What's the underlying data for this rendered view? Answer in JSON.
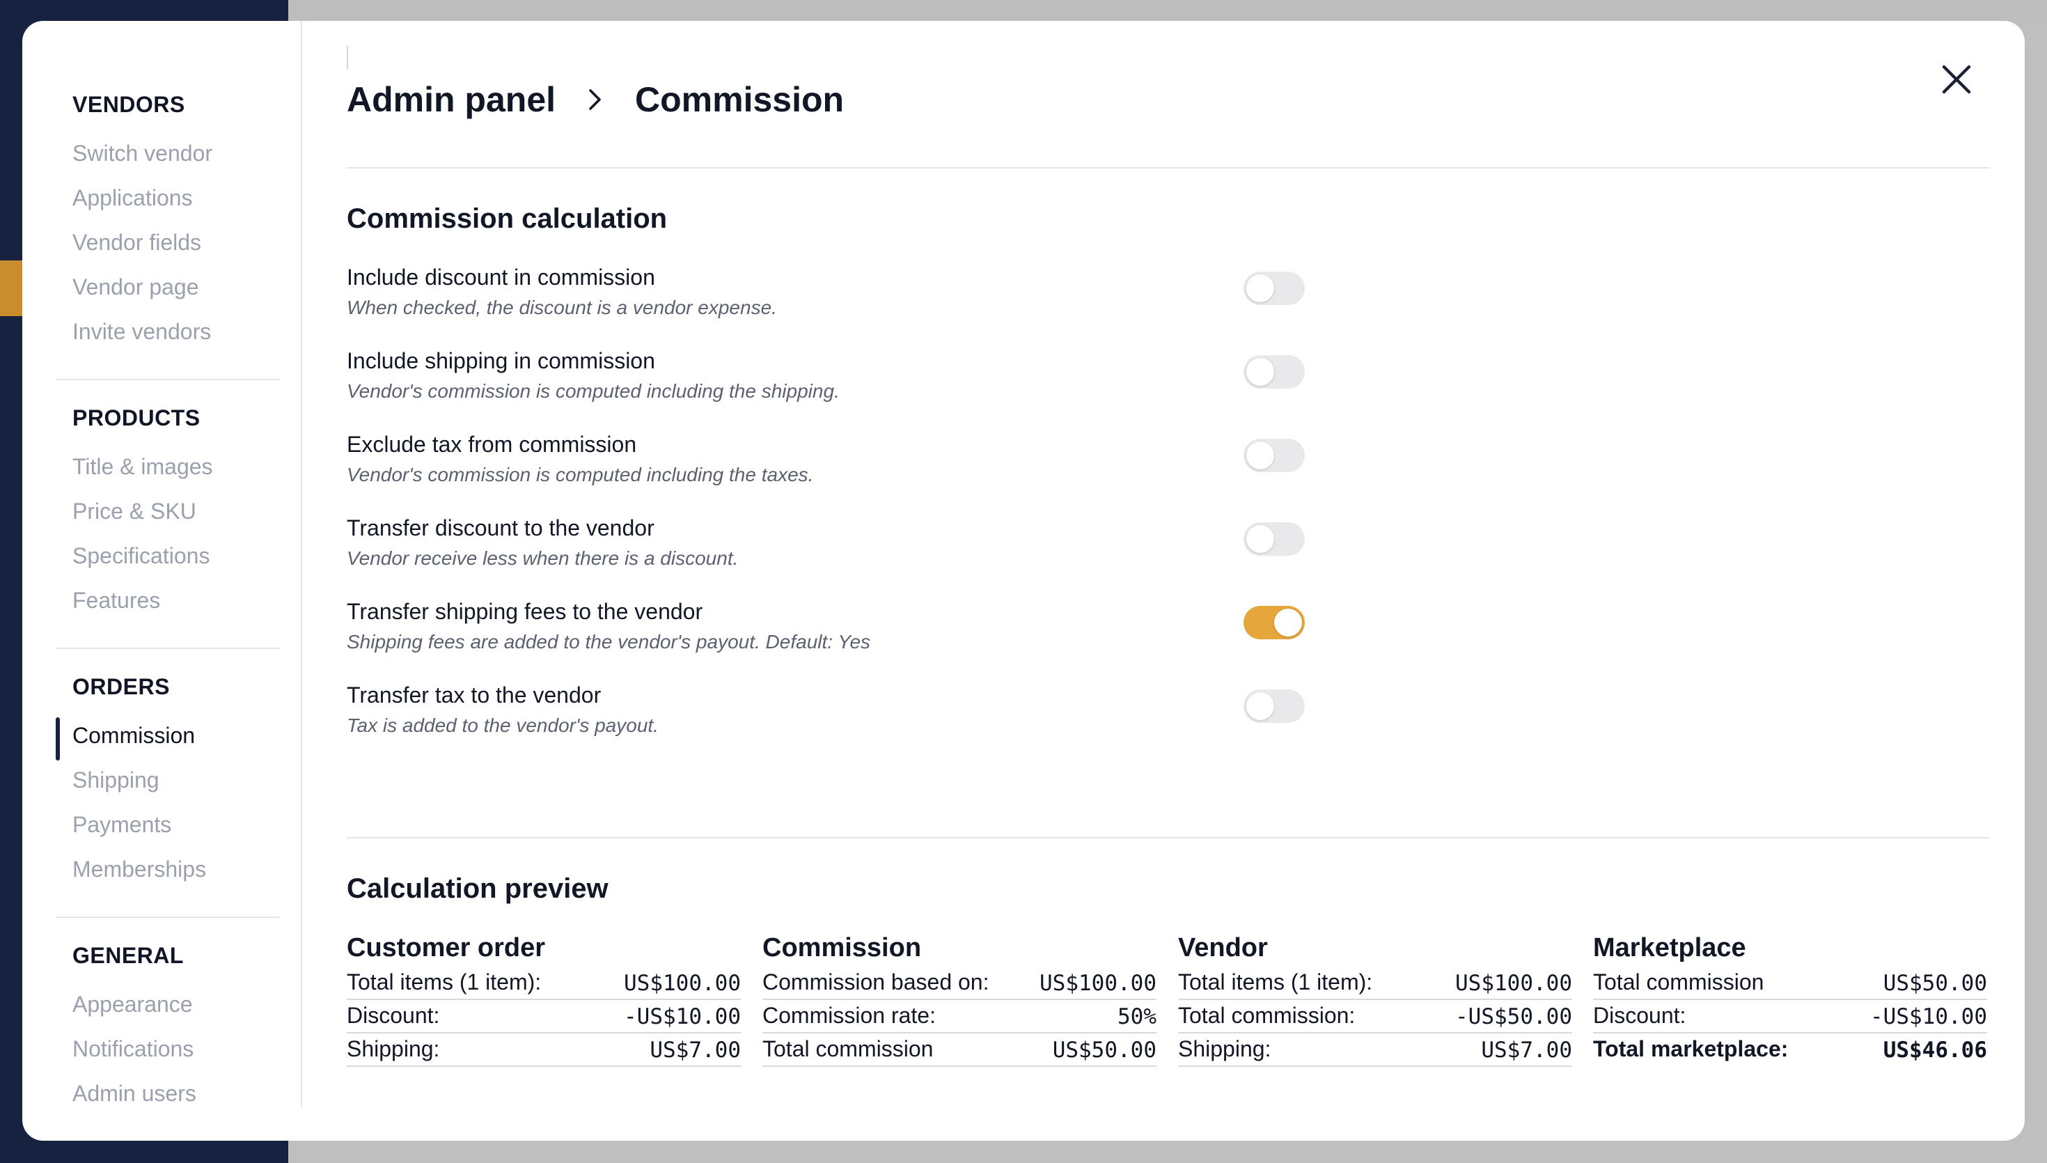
{
  "sidebar": {
    "sections": [
      {
        "title": "VENDORS",
        "items": [
          "Switch vendor",
          "Applications",
          "Vendor fields",
          "Vendor page",
          "Invite vendors"
        ]
      },
      {
        "title": "PRODUCTS",
        "items": [
          "Title & images",
          "Price & SKU",
          "Specifications",
          "Features"
        ]
      },
      {
        "title": "ORDERS",
        "items": [
          "Commission",
          "Shipping",
          "Payments",
          "Memberships"
        ]
      },
      {
        "title": "GENERAL",
        "items": [
          "Appearance",
          "Notifications",
          "Admin users"
        ]
      }
    ],
    "active_item": "Commission"
  },
  "header": {
    "breadcrumb": [
      "Admin panel",
      "Commission"
    ]
  },
  "commission_calculation": {
    "title": "Commission calculation",
    "settings": [
      {
        "label": "Include discount in commission",
        "description": "When checked, the discount is a vendor expense.",
        "enabled": false
      },
      {
        "label": "Include shipping in commission",
        "description": "Vendor's commission is computed including the shipping.",
        "enabled": false
      },
      {
        "label": "Exclude tax from commission",
        "description": "Vendor's commission is computed including the taxes.",
        "enabled": false
      },
      {
        "label": "Transfer discount to the vendor",
        "description": "Vendor receive less when there is a discount.",
        "enabled": false
      },
      {
        "label": "Transfer shipping fees to the vendor",
        "description": "Shipping fees are added to the vendor's payout. Default: Yes",
        "enabled": true
      },
      {
        "label": "Transfer tax to the vendor",
        "description": "Tax is added to the vendor's payout.",
        "enabled": false
      }
    ]
  },
  "calculation_preview": {
    "title": "Calculation preview",
    "columns": [
      {
        "title": "Customer order",
        "rows": [
          {
            "label": "Total items (1 item):",
            "value": "US$100.00"
          },
          {
            "label": "Discount:",
            "value": "-US$10.00"
          },
          {
            "label": "Shipping:",
            "value": "US$7.00"
          }
        ]
      },
      {
        "title": "Commission",
        "rows": [
          {
            "label": "Commission based on:",
            "value": "US$100.00"
          },
          {
            "label": "Commission rate:",
            "value": "50%"
          },
          {
            "label": "Total commission",
            "value": "US$50.00"
          }
        ]
      },
      {
        "title": "Vendor",
        "rows": [
          {
            "label": "Total items (1 item):",
            "value": "US$100.00"
          },
          {
            "label": "Total commission:",
            "value": "-US$50.00"
          },
          {
            "label": "Shipping:",
            "value": "US$7.00"
          }
        ]
      },
      {
        "title": "Marketplace",
        "rows": [
          {
            "label": "Total commission",
            "value": "US$50.00"
          },
          {
            "label": "Discount:",
            "value": "-US$10.00"
          },
          {
            "label": "Total marketplace:",
            "value": "US$46.06",
            "bold": true
          }
        ]
      }
    ]
  },
  "icons": {
    "breadcrumb_separator": "chevron-right-icon",
    "close": "close-icon"
  },
  "colors": {
    "accent": "#e5a63b",
    "navy": "#172241",
    "toggle_off": "#e9e9ec"
  }
}
